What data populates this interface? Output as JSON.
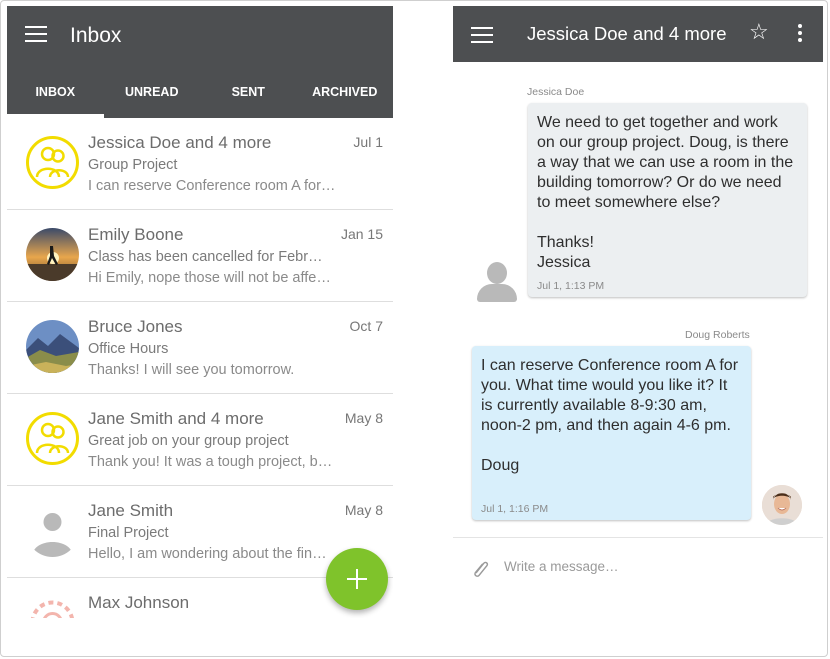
{
  "left": {
    "title": "Inbox",
    "tabs": [
      {
        "label": "INBOX",
        "active": true
      },
      {
        "label": "UNREAD",
        "active": false
      },
      {
        "label": "SENT",
        "active": false
      },
      {
        "label": "ARCHIVED",
        "active": false
      }
    ],
    "conversations": [
      {
        "name": "Jessica Doe and 4 more",
        "date": "Jul 1",
        "subject": "Group Project",
        "preview": "I can reserve Conference room A for…",
        "avatar": "group-icon"
      },
      {
        "name": "Emily Boone",
        "date": "Jan 15",
        "subject": "Class has been cancelled for Febr…",
        "preview": "Hi Emily, nope those will not be affe…",
        "avatar": "sunset-photo"
      },
      {
        "name": "Bruce Jones",
        "date": "Oct 7",
        "subject": "Office Hours",
        "preview": "Thanks! I will see you tomorrow.",
        "avatar": "landscape-photo"
      },
      {
        "name": "Jane Smith and 4 more",
        "date": "May 8",
        "subject": "Great job on your group project",
        "preview": "Thank you! It was a tough project, b…",
        "avatar": "group-icon"
      },
      {
        "name": "Jane Smith",
        "date": "May 8",
        "subject": "Final Project",
        "preview": "Hello, I am wondering about the fin…",
        "avatar": "person-icon"
      },
      {
        "name": "Max Johnson",
        "date": "",
        "subject": "",
        "preview": "",
        "avatar": "logo-icon"
      }
    ],
    "fab_icon": "plus-icon"
  },
  "right": {
    "title": "Jessica Doe and 4 more",
    "messages": [
      {
        "sender": "Jessica Doe",
        "text": "We need to get together and work on our group project. Doug, is there a way that we can use a room in the building tomorrow? Or do we need to meet somewhere else?\n\nThanks!\nJessica",
        "time": "Jul 1, 1:13 PM"
      },
      {
        "sender": "Doug Roberts",
        "text": "I can reserve Conference room A for you. What time would you like it? It is currently available 8-9:30 am, noon-2 pm, and then again 4-6 pm.\n\nDoug",
        "time": "Jul 1, 1:16 PM"
      }
    ],
    "composer_placeholder": "Write a message…"
  },
  "colors": {
    "header": "#4d4f51",
    "fab": "#7fc32b",
    "group_avatar": "#f2dc00",
    "incoming_bubble": "#eceff1",
    "outgoing_bubble": "#d8effb"
  }
}
